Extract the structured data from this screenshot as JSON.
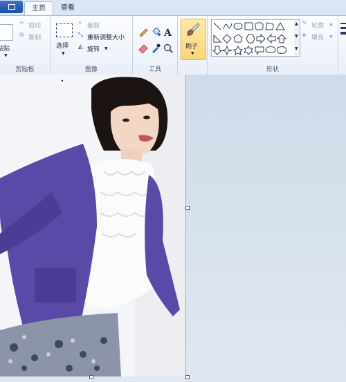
{
  "tabs": {
    "file": "",
    "home": "主页",
    "view": "查看"
  },
  "clipboard": {
    "paste": "粘贴",
    "cut": "剪切",
    "copy": "复制",
    "group": "剪贴板"
  },
  "image": {
    "select": "选择",
    "crop": "裁剪",
    "resize": "重新调整大小",
    "rotate": "旋转",
    "group": "图像"
  },
  "tools": {
    "group": "工具"
  },
  "brush": {
    "label": "刷子"
  },
  "shapes": {
    "outline": "轮廓",
    "fill": "填充",
    "group": "形状"
  },
  "colors": {
    "accent": "#2b6ac6",
    "brush_active": "#fbd675",
    "purple_cardigan": "#5a4aa8"
  }
}
